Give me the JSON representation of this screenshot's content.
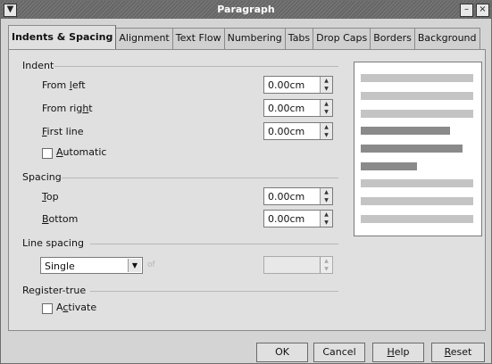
{
  "window": {
    "title": "Paragraph",
    "menu_glyph": "▼",
    "minimize_glyph": "–",
    "close_glyph": "×"
  },
  "tabs": [
    {
      "label": "Indents & Spacing",
      "active": true
    },
    {
      "label": "Alignment"
    },
    {
      "label": "Text Flow"
    },
    {
      "label": "Numbering"
    },
    {
      "label": "Tabs"
    },
    {
      "label": "Drop Caps"
    },
    {
      "label": "Borders"
    },
    {
      "label": "Background"
    }
  ],
  "indent": {
    "heading": "Indent",
    "from_left": {
      "pre": "From ",
      "u": "l",
      "post": "eft",
      "value": "0.00cm"
    },
    "from_right": {
      "pre": "From rig",
      "u": "h",
      "post": "t",
      "value": "0.00cm"
    },
    "first_line": {
      "pre": "",
      "u": "F",
      "post": "irst line",
      "value": "0.00cm"
    },
    "automatic": {
      "pre": "",
      "u": "A",
      "post": "utomatic",
      "checked": false
    }
  },
  "spacing": {
    "heading": "Spacing",
    "top": {
      "pre": "",
      "u": "T",
      "post": "op",
      "value": "0.00cm"
    },
    "bottom": {
      "pre": "",
      "u": "B",
      "post": "ottom",
      "value": "0.00cm"
    }
  },
  "line_spacing": {
    "heading": "Line spacing",
    "selected": "Single",
    "of_label": "of",
    "value": ""
  },
  "register_true": {
    "heading": "Register-true",
    "activate": {
      "pre": "A",
      "u": "c",
      "post": "tivate",
      "checked": false
    }
  },
  "spin_glyphs": {
    "up": "▲",
    "down": "▼"
  },
  "buttons": {
    "ok": "OK",
    "cancel": "Cancel",
    "help": {
      "pre": "",
      "u": "H",
      "post": "elp"
    },
    "reset": {
      "pre": "",
      "u": "R",
      "post": "eset"
    }
  },
  "colors": {
    "preview_light": "#c4c4c4",
    "preview_dark": "#8a8a8a"
  }
}
